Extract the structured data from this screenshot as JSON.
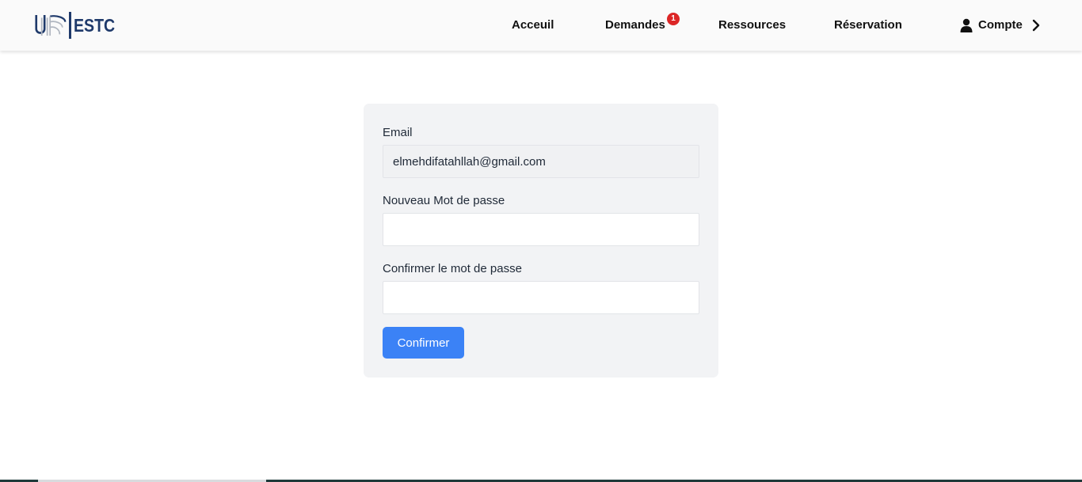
{
  "brand": {
    "logo_text": "ESTC",
    "accent": "#1f3a6b"
  },
  "nav": {
    "acceuil": "Acceuil",
    "demandes": "Demandes",
    "demandes_badge": "1",
    "ressources": "Ressources",
    "reservation": "Réservation",
    "compte": "Compte"
  },
  "form": {
    "email_label": "Email",
    "email_value": "elmehdifatahllah@gmail.com",
    "new_password_label": "Nouveau Mot de passe",
    "new_password_value": "",
    "confirm_password_label": "Confirmer le mot de passe",
    "confirm_password_value": "",
    "submit_label": "Confirmer"
  },
  "colors": {
    "primary_button": "#3b82f6",
    "badge": "#dc2626",
    "card_bg": "#f2f3f5"
  },
  "icons": {
    "account": "user-icon",
    "chevron": "chevron-right-icon"
  }
}
